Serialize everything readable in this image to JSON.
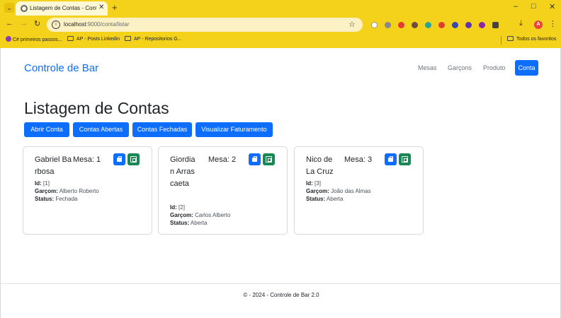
{
  "browser": {
    "tab_title": "Listagem de Contas - Controle de Bar",
    "tab_close": "✕",
    "new_tab": "+",
    "url_host": "localhost",
    "url_path": ":9000/conta/listar",
    "window_controls": [
      "–",
      "□",
      "✕"
    ],
    "bookmarks": [
      {
        "label": "C# primeiros passos...",
        "icon": "csharp-icon"
      },
      {
        "label": "AP - Posts Linkedin",
        "icon": "folder-icon"
      },
      {
        "label": "AP - Repositorios G...",
        "icon": "folder-icon"
      }
    ],
    "all_bookmarks": "Todos os favoritos",
    "profile_initial": "A",
    "accent": "#f4d21b"
  },
  "navbar": {
    "brand": "Controle de Bar",
    "links": [
      "Mesas",
      "Garçons",
      "Produto"
    ],
    "active": "Conta"
  },
  "main": {
    "title": "Listagem de Contas",
    "buttons": [
      "Abrir Conta",
      "Contas Abertas",
      "Contas Fechadas",
      "Visualizar Faturamento"
    ]
  },
  "labels": {
    "id": "Id:",
    "garcom": "Garçom:",
    "status": "Status:"
  },
  "contas": [
    {
      "nome": "Gabriel Barbosa",
      "mesa": "Mesa: 1",
      "id": "[1]",
      "garcom": "Alberto Roberto",
      "status": "Fechada"
    },
    {
      "nome": "Giordian Arrascaeta",
      "mesa": "Mesa: 2",
      "id": "[2]",
      "garcom": "Carlos Alberto",
      "status": "Aberta"
    },
    {
      "nome": "Nico de La Cruz",
      "mesa": "Mesa: 3",
      "id": "[3]",
      "garcom": "João das Almas",
      "status": "Aberta"
    }
  ],
  "footer": "© - 2024 - Controle de Bar 2.0",
  "colors": {
    "primary": "#0d6efd",
    "success": "#198754"
  }
}
